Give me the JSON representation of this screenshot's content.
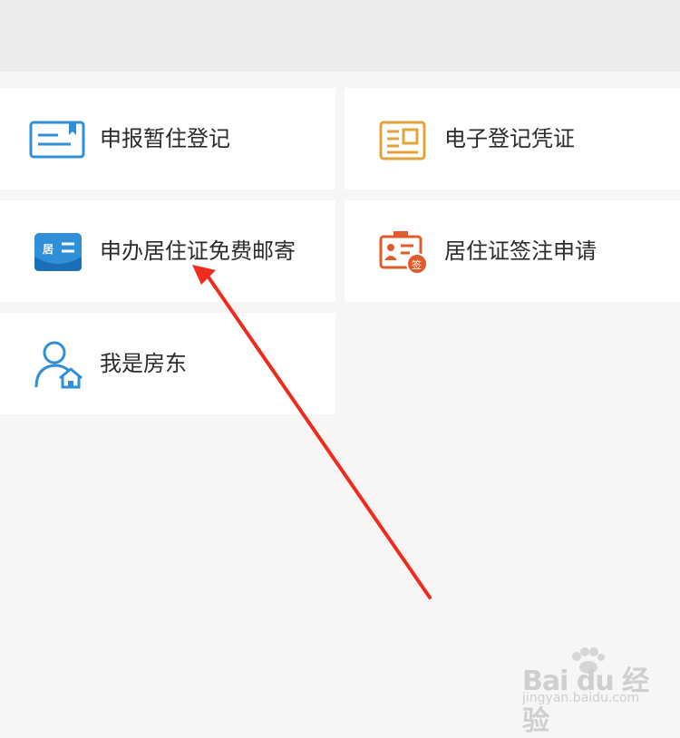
{
  "services": [
    {
      "label": "申报暂住登记",
      "icon": "registration-card-icon",
      "color": "#2f8fd8"
    },
    {
      "label": "电子登记凭证",
      "icon": "certificate-document-icon",
      "color": "#e3a23a"
    },
    {
      "label": "申办居住证免费邮寄",
      "icon": "residence-permit-mail-icon",
      "color": "#2f8fd8",
      "icon_text": "居"
    },
    {
      "label": "居住证签注申请",
      "icon": "id-badge-endorse-icon",
      "color": "#e05a2b",
      "icon_text": "签"
    },
    {
      "label": "我是房东",
      "icon": "landlord-icon",
      "color": "#2f8fd8"
    }
  ],
  "annotation": {
    "type": "red-arrow",
    "color": "#f02a1e"
  },
  "watermark": {
    "brand": "Bai du 经验",
    "url": "jingyan.baidu.com"
  }
}
